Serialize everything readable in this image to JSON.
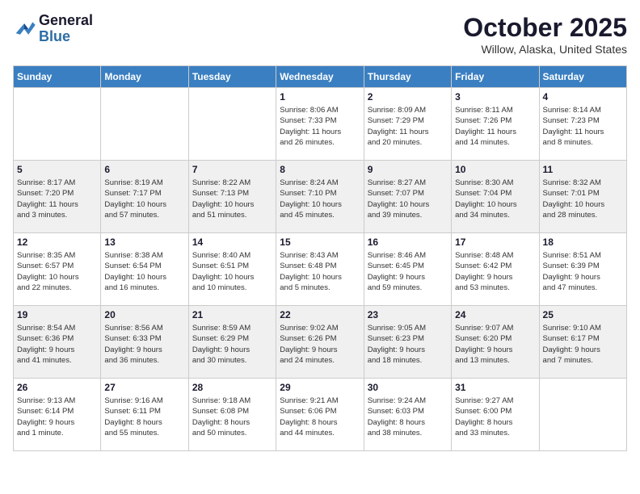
{
  "header": {
    "logo_general": "General",
    "logo_blue": "Blue",
    "month_title": "October 2025",
    "location": "Willow, Alaska, United States"
  },
  "weekdays": [
    "Sunday",
    "Monday",
    "Tuesday",
    "Wednesday",
    "Thursday",
    "Friday",
    "Saturday"
  ],
  "weeks": [
    [
      {
        "day": "",
        "info": ""
      },
      {
        "day": "",
        "info": ""
      },
      {
        "day": "",
        "info": ""
      },
      {
        "day": "1",
        "info": "Sunrise: 8:06 AM\nSunset: 7:33 PM\nDaylight: 11 hours\nand 26 minutes."
      },
      {
        "day": "2",
        "info": "Sunrise: 8:09 AM\nSunset: 7:29 PM\nDaylight: 11 hours\nand 20 minutes."
      },
      {
        "day": "3",
        "info": "Sunrise: 8:11 AM\nSunset: 7:26 PM\nDaylight: 11 hours\nand 14 minutes."
      },
      {
        "day": "4",
        "info": "Sunrise: 8:14 AM\nSunset: 7:23 PM\nDaylight: 11 hours\nand 8 minutes."
      }
    ],
    [
      {
        "day": "5",
        "info": "Sunrise: 8:17 AM\nSunset: 7:20 PM\nDaylight: 11 hours\nand 3 minutes."
      },
      {
        "day": "6",
        "info": "Sunrise: 8:19 AM\nSunset: 7:17 PM\nDaylight: 10 hours\nand 57 minutes."
      },
      {
        "day": "7",
        "info": "Sunrise: 8:22 AM\nSunset: 7:13 PM\nDaylight: 10 hours\nand 51 minutes."
      },
      {
        "day": "8",
        "info": "Sunrise: 8:24 AM\nSunset: 7:10 PM\nDaylight: 10 hours\nand 45 minutes."
      },
      {
        "day": "9",
        "info": "Sunrise: 8:27 AM\nSunset: 7:07 PM\nDaylight: 10 hours\nand 39 minutes."
      },
      {
        "day": "10",
        "info": "Sunrise: 8:30 AM\nSunset: 7:04 PM\nDaylight: 10 hours\nand 34 minutes."
      },
      {
        "day": "11",
        "info": "Sunrise: 8:32 AM\nSunset: 7:01 PM\nDaylight: 10 hours\nand 28 minutes."
      }
    ],
    [
      {
        "day": "12",
        "info": "Sunrise: 8:35 AM\nSunset: 6:57 PM\nDaylight: 10 hours\nand 22 minutes."
      },
      {
        "day": "13",
        "info": "Sunrise: 8:38 AM\nSunset: 6:54 PM\nDaylight: 10 hours\nand 16 minutes."
      },
      {
        "day": "14",
        "info": "Sunrise: 8:40 AM\nSunset: 6:51 PM\nDaylight: 10 hours\nand 10 minutes."
      },
      {
        "day": "15",
        "info": "Sunrise: 8:43 AM\nSunset: 6:48 PM\nDaylight: 10 hours\nand 5 minutes."
      },
      {
        "day": "16",
        "info": "Sunrise: 8:46 AM\nSunset: 6:45 PM\nDaylight: 9 hours\nand 59 minutes."
      },
      {
        "day": "17",
        "info": "Sunrise: 8:48 AM\nSunset: 6:42 PM\nDaylight: 9 hours\nand 53 minutes."
      },
      {
        "day": "18",
        "info": "Sunrise: 8:51 AM\nSunset: 6:39 PM\nDaylight: 9 hours\nand 47 minutes."
      }
    ],
    [
      {
        "day": "19",
        "info": "Sunrise: 8:54 AM\nSunset: 6:36 PM\nDaylight: 9 hours\nand 41 minutes."
      },
      {
        "day": "20",
        "info": "Sunrise: 8:56 AM\nSunset: 6:33 PM\nDaylight: 9 hours\nand 36 minutes."
      },
      {
        "day": "21",
        "info": "Sunrise: 8:59 AM\nSunset: 6:29 PM\nDaylight: 9 hours\nand 30 minutes."
      },
      {
        "day": "22",
        "info": "Sunrise: 9:02 AM\nSunset: 6:26 PM\nDaylight: 9 hours\nand 24 minutes."
      },
      {
        "day": "23",
        "info": "Sunrise: 9:05 AM\nSunset: 6:23 PM\nDaylight: 9 hours\nand 18 minutes."
      },
      {
        "day": "24",
        "info": "Sunrise: 9:07 AM\nSunset: 6:20 PM\nDaylight: 9 hours\nand 13 minutes."
      },
      {
        "day": "25",
        "info": "Sunrise: 9:10 AM\nSunset: 6:17 PM\nDaylight: 9 hours\nand 7 minutes."
      }
    ],
    [
      {
        "day": "26",
        "info": "Sunrise: 9:13 AM\nSunset: 6:14 PM\nDaylight: 9 hours\nand 1 minute."
      },
      {
        "day": "27",
        "info": "Sunrise: 9:16 AM\nSunset: 6:11 PM\nDaylight: 8 hours\nand 55 minutes."
      },
      {
        "day": "28",
        "info": "Sunrise: 9:18 AM\nSunset: 6:08 PM\nDaylight: 8 hours\nand 50 minutes."
      },
      {
        "day": "29",
        "info": "Sunrise: 9:21 AM\nSunset: 6:06 PM\nDaylight: 8 hours\nand 44 minutes."
      },
      {
        "day": "30",
        "info": "Sunrise: 9:24 AM\nSunset: 6:03 PM\nDaylight: 8 hours\nand 38 minutes."
      },
      {
        "day": "31",
        "info": "Sunrise: 9:27 AM\nSunset: 6:00 PM\nDaylight: 8 hours\nand 33 minutes."
      },
      {
        "day": "",
        "info": ""
      }
    ]
  ]
}
